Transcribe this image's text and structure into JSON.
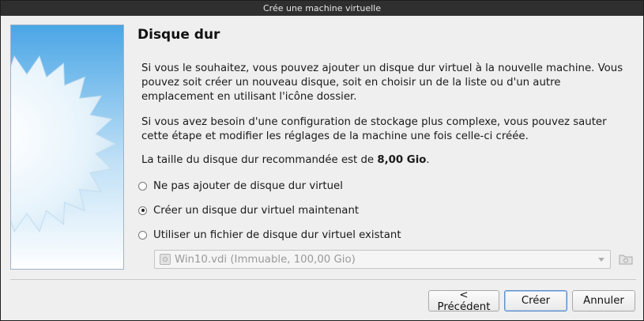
{
  "window": {
    "title": "Crée une machine virtuelle"
  },
  "page": {
    "title": "Disque dur",
    "intro": "Si vous le souhaitez, vous pouvez ajouter un disque dur virtuel à la nouvelle machine. Vous pouvez soit créer un nouveau disque, soit en choisir un de la liste ou d'un autre emplacement en utilisant l'icône dossier.",
    "advanced": "Si vous avez besoin d'une configuration de stockage plus complexe, vous pouvez sauter cette étape et modifier les réglages de la machine une fois celle-ci créée.",
    "recommended_prefix": "La taille du disque dur recommandée est de ",
    "recommended_size": "8,00 Gio",
    "recommended_suffix": "."
  },
  "options": [
    {
      "label": "Ne pas ajouter de disque dur virtuel",
      "checked": false
    },
    {
      "label": "Créer un disque dur virtuel maintenant",
      "checked": true
    },
    {
      "label": "Utiliser un fichier de disque dur virtuel existant",
      "checked": false
    }
  ],
  "existing_disk": {
    "value": "Win10.vdi (Immuable, 100,00 Gio)",
    "icon": "disk-icon",
    "enabled": false
  },
  "buttons": {
    "back": "< Précédent",
    "create": "Créer",
    "cancel": "Annuler"
  },
  "colors": {
    "accent": "#5d8fc9",
    "titlebar": "#2f2f2f"
  }
}
